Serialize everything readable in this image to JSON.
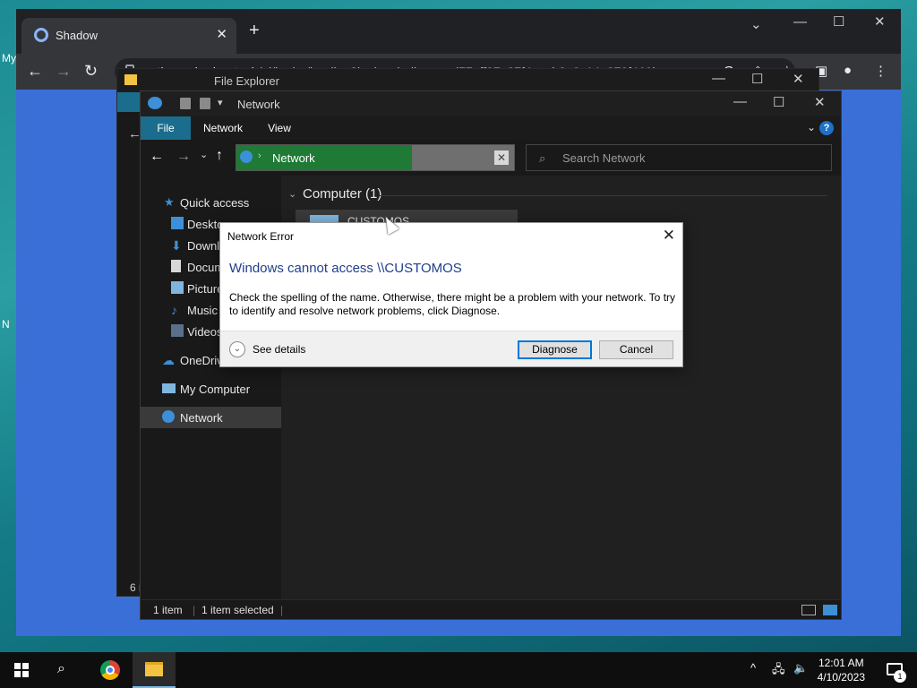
{
  "desktop": {
    "stub_texts": [
      "My",
      "N"
    ]
  },
  "browser": {
    "tab_title": "Shadow",
    "url_host": "auth.eu.shadow.tech",
    "url_path": "/ui/hydra/landing?login_challenge=d77eff37a37f4acab3e0c14e270f469b"
  },
  "explorer_back": {
    "title": "File Explorer",
    "status_count": "6 i"
  },
  "explorer": {
    "title": "Network",
    "ribbon_tabs": [
      "File",
      "Network",
      "View"
    ],
    "address": "Network",
    "search_placeholder": "Search Network",
    "nav_items": [
      "Quick access",
      "Desktop",
      "Downloads",
      "Documents",
      "Pictures",
      "Music",
      "Videos",
      "OneDrive",
      "My Computer",
      "Network"
    ],
    "group_header": "Computer (1)",
    "tile_label": "CUSTOMOS",
    "status_items": "1 item",
    "status_selected": "1 item selected"
  },
  "dialog": {
    "title": "Network Error",
    "heading": "Windows cannot access \\\\CUSTOMOS",
    "body": "Check the spelling of the name. Otherwise, there might be a problem with your network. To try to identify and resolve network problems, click Diagnose.",
    "see_details": "See details",
    "diagnose_label": "Diagnose",
    "cancel_label": "Cancel"
  },
  "taskbar": {
    "time": "12:01 AM",
    "date": "4/10/2023",
    "notification_count": "1"
  },
  "colors": {
    "accent": "#0078d7",
    "address_progress": "#1e7a34",
    "file_tab": "#1a6d8c",
    "dialog_heading": "#1f3f8c"
  }
}
